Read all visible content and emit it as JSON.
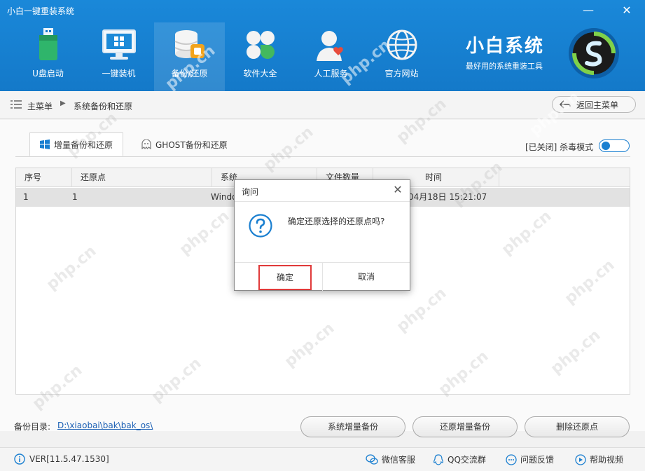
{
  "window": {
    "title": "小白一键重装系统",
    "minimize": "—",
    "close": "✕"
  },
  "nav": {
    "items": [
      {
        "label": "U盘启动",
        "icon": "usb-drive-icon"
      },
      {
        "label": "一键装机",
        "icon": "monitor-windows-icon"
      },
      {
        "label": "备份/还原",
        "icon": "database-backup-icon"
      },
      {
        "label": "软件大全",
        "icon": "clover-apps-icon"
      },
      {
        "label": "人工服务",
        "icon": "user-heart-icon"
      },
      {
        "label": "官方网站",
        "icon": "globe-icon"
      }
    ],
    "active_index": 2
  },
  "brand": {
    "name": "小白系统",
    "slogan": "最好用的系统重装工具"
  },
  "breadcrumb": {
    "root": "主菜单",
    "current": "系统备份和还原",
    "back_label": "返回主菜单"
  },
  "tabs": [
    {
      "label": "增量备份和还原",
      "icon": "windows-logo-icon"
    },
    {
      "label": "GHOST备份和还原",
      "icon": "ghost-icon"
    }
  ],
  "antivirus": {
    "label": "[已关闭] 杀毒模式",
    "state": "off"
  },
  "table": {
    "columns": [
      "序号",
      "还原点",
      "系统",
      "文件数量",
      "时间"
    ],
    "rows": [
      {
        "index": "1",
        "point": "1",
        "system": "Windo",
        "count": "",
        "time": "04月18日 15:21:07"
      }
    ]
  },
  "backup_dir": {
    "label": "备份目录:",
    "path": "D:\\xiaobai\\bak\\bak_os\\"
  },
  "actions": {
    "backup": "系统增量备份",
    "restore": "还原增量备份",
    "delete": "删除还原点"
  },
  "footer": {
    "version": "VER[11.5.47.1530]",
    "links": [
      {
        "label": "微信客服",
        "icon": "wechat-icon"
      },
      {
        "label": "QQ交流群",
        "icon": "qq-icon"
      },
      {
        "label": "问题反馈",
        "icon": "feedback-icon"
      },
      {
        "label": "帮助视频",
        "icon": "help-video-icon"
      }
    ]
  },
  "dialog": {
    "title": "询问",
    "message": "确定还原选择的还原点吗?",
    "ok": "确定",
    "cancel": "取消",
    "close": "✕"
  },
  "watermark": "php.cn",
  "colors": {
    "header": "#1479c9",
    "accent": "#1a7fd0",
    "highlight_border": "#e03a3a",
    "selected_row": "#e2e2e2"
  }
}
